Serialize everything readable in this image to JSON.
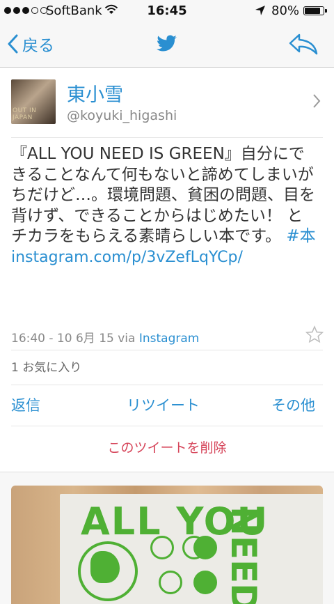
{
  "status_bar": {
    "carrier": "SoftBank",
    "time": "16:45",
    "battery": "80%",
    "battery_level": 0.8
  },
  "nav": {
    "back_label": "戻る"
  },
  "tweet": {
    "name": "東小雪",
    "handle": "@koyuki_higashi",
    "text": "『ALL YOU NEED IS GREEN』自分にできることなんて何もないと諦めてしまいがちだけど…。環境問題、貧困の問題、目を背けず、できることからはじめたい！ とチカラをもらえる素晴らしい本です。",
    "hashtag": "#本",
    "link": "instagram.com/p/3vZefLqYCp/",
    "timestamp": "16:40 - 10 6月 15 via",
    "via_app": "Instagram",
    "favorites": "1 お気に入り"
  },
  "actions": {
    "reply": "返信",
    "retweet": "リツイート",
    "more": "その他"
  },
  "delete_label": "このツイートを削除",
  "avatar_caption": "OUT IN JAPAN",
  "photo": {
    "title": "ALL YOU",
    "title_side": "NEED"
  },
  "colors": {
    "accent": "#2a8fd1",
    "delete": "#d6455a",
    "book_green": "#4fb034"
  }
}
